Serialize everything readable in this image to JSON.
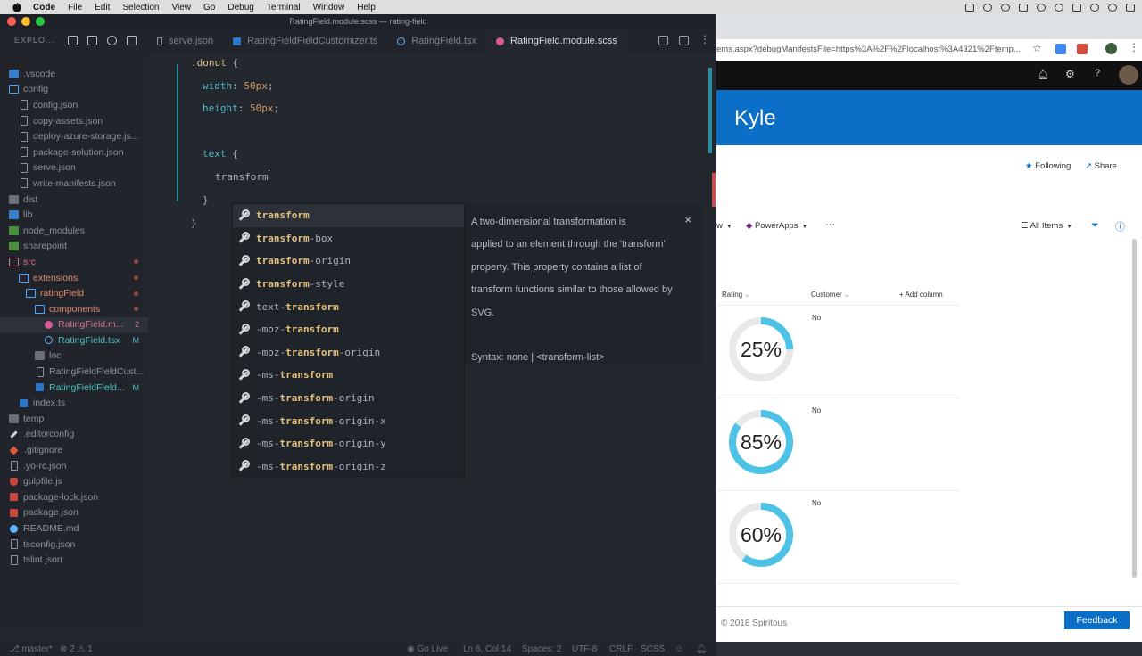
{
  "menubar": {
    "app": "Code",
    "items": [
      "File",
      "Edit",
      "Selection",
      "View",
      "Go",
      "Debug",
      "Terminal",
      "Window",
      "Help"
    ]
  },
  "window_title": "RatingField.module.scss — rating-field",
  "explorer": {
    "label": "EXPLO...",
    "items": [
      {
        "label": ".vscode",
        "icon": "folder-icon"
      },
      {
        "label": "config",
        "icon": "folder-open-icon"
      },
      {
        "label": "config.json",
        "icon": "json-file-icon"
      },
      {
        "label": "copy-assets.json",
        "icon": "json-file-icon"
      },
      {
        "label": "deploy-azure-storage.js...",
        "icon": "json-file-icon"
      },
      {
        "label": "package-solution.json",
        "icon": "json-file-icon"
      },
      {
        "label": "serve.json",
        "icon": "json-file-icon"
      },
      {
        "label": "write-manifests.json",
        "icon": "json-file-icon"
      },
      {
        "label": "dist",
        "icon": "folder-icon"
      },
      {
        "label": "lib",
        "icon": "folder-icon"
      },
      {
        "label": "node_modules",
        "icon": "folder-icon"
      },
      {
        "label": "sharepoint",
        "icon": "folder-icon"
      },
      {
        "label": "src",
        "icon": "folder-open-icon"
      },
      {
        "label": "extensions",
        "icon": "folder-open-icon"
      },
      {
        "label": "ratingField",
        "icon": "folder-open-icon"
      },
      {
        "label": "components",
        "icon": "folder-open-icon"
      },
      {
        "label": "RatingField.m...",
        "icon": "sass-file-icon",
        "badge": "2"
      },
      {
        "label": "RatingField.tsx",
        "icon": "react-file-icon",
        "badge": "M"
      },
      {
        "label": "loc",
        "icon": "folder-icon"
      },
      {
        "label": "RatingFieldFieldCust...",
        "icon": "json-file-icon"
      },
      {
        "label": "RatingFieldField...",
        "icon": "ts-file-icon",
        "badge": "M"
      },
      {
        "label": "index.ts",
        "icon": "ts-file-icon"
      },
      {
        "label": "temp",
        "icon": "folder-icon"
      },
      {
        "label": ".editorconfig",
        "icon": "wrench-icon"
      },
      {
        "label": ".gitignore",
        "icon": "git-icon"
      },
      {
        "label": ".yo-rc.json",
        "icon": "json-file-icon"
      },
      {
        "label": "gulpfile.js",
        "icon": "gulp-icon"
      },
      {
        "label": "package-lock.json",
        "icon": "npm-icon"
      },
      {
        "label": "package.json",
        "icon": "npm-icon"
      },
      {
        "label": "README.md",
        "icon": "info-icon"
      },
      {
        "label": "tsconfig.json",
        "icon": "json-file-icon"
      },
      {
        "label": "tslint.json",
        "icon": "json-file-icon"
      }
    ]
  },
  "tabs": [
    {
      "label": "serve.json",
      "icon": "json-file-icon"
    },
    {
      "label": "RatingFieldFieldCustomizer.ts",
      "icon": "ts-file-icon"
    },
    {
      "label": "RatingField.tsx",
      "icon": "react-file-icon"
    },
    {
      "label": "RatingField.module.scss",
      "icon": "sass-file-icon",
      "active": true
    }
  ],
  "code": {
    "l1_sel": ".donut",
    "l1_brace": " {",
    "l2_prop": "width",
    "l2_val": "50px",
    "l3_prop": "height",
    "l3_val": "50px",
    "l5_sel": "text",
    "l5_brace": " {",
    "l6_typed": "transform",
    "l7": "}",
    "l8": "}",
    "colon": ":",
    "semi": ";"
  },
  "suggestions": [
    {
      "prefix": "",
      "match": "transform",
      "suffix": ""
    },
    {
      "prefix": "",
      "match": "transform",
      "suffix": "-box"
    },
    {
      "prefix": "",
      "match": "transform",
      "suffix": "-origin"
    },
    {
      "prefix": "",
      "match": "transform",
      "suffix": "-style"
    },
    {
      "prefix": "text-",
      "match": "transform",
      "suffix": ""
    },
    {
      "prefix": "-moz-",
      "match": "transform",
      "suffix": ""
    },
    {
      "prefix": "-moz-",
      "match": "transform",
      "suffix": "-origin"
    },
    {
      "prefix": "-ms-",
      "match": "transform",
      "suffix": ""
    },
    {
      "prefix": "-ms-",
      "match": "transform",
      "suffix": "-origin"
    },
    {
      "prefix": "-ms-",
      "match": "transform",
      "suffix": "-origin-x"
    },
    {
      "prefix": "-ms-",
      "match": "transform",
      "suffix": "-origin-y"
    },
    {
      "prefix": "-ms-",
      "match": "transform",
      "suffix": "-origin-z"
    }
  ],
  "docs": {
    "lines": [
      "A two-dimensional transformation is",
      "applied to an element through the 'transform'",
      "property. This property contains a list of",
      "transform functions similar to those allowed by",
      "SVG.",
      "",
      "Syntax: none | <transform-list>"
    ],
    "close": "×"
  },
  "statusbar": {
    "branch": "master*",
    "errors": "2",
    "warnings": "1",
    "golive": "Go Live",
    "position": "Ln 6, Col 14",
    "spaces": "Spaces: 2",
    "encoding": "UTF-8",
    "eol": "CRLF",
    "language": "SCSS"
  },
  "browser": {
    "url": "ems.aspx?debugManifestsFile=https%3A%2F%2Flocalhost%3A4321%2Ftemp...",
    "site_title": "Kyle",
    "following": "Following",
    "share": "Share",
    "view_fragment": "w",
    "powerapps": "PowerApps",
    "more": "···",
    "all_items": "All Items",
    "columns": {
      "rating": "Rating",
      "customer": "Customer",
      "add": "Add column"
    },
    "rows": [
      {
        "rating": 25,
        "label": "25%",
        "customer": "No"
      },
      {
        "rating": 85,
        "label": "85%",
        "customer": "No"
      },
      {
        "rating": 60,
        "label": "60%",
        "customer": "No"
      }
    ],
    "footer": "© 2018 Spiritous",
    "feedback": "Feedback"
  },
  "colors": {
    "donut_fill": "#4cc3e6",
    "donut_track": "#e8e8e8",
    "accent_blue": "#0b6fc8"
  }
}
